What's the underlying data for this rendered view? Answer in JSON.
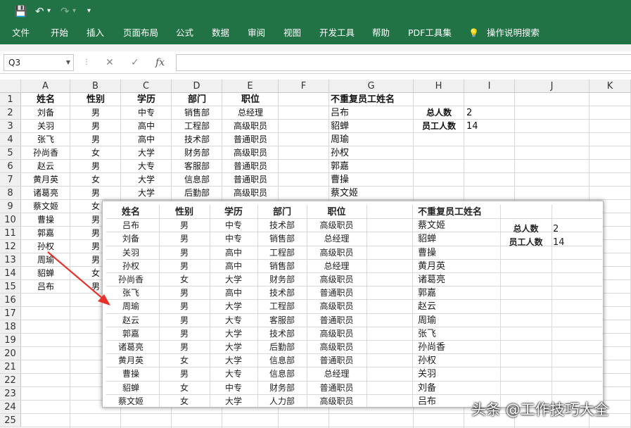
{
  "quick_access": {
    "save_icon": "💾",
    "undo_icon": "↶",
    "undo_dropdown": "▾",
    "redo_icon": "↷",
    "redo_dropdown": "▾",
    "customize_icon": "▾"
  },
  "menu": [
    "文件",
    "开始",
    "插入",
    "页面布局",
    "公式",
    "数据",
    "审阅",
    "视图",
    "开发工具",
    "帮助",
    "PDF工具集"
  ],
  "tell_me": {
    "icon": "💡",
    "label": "操作说明搜索"
  },
  "formula_bar": {
    "name_box": "Q3",
    "cancel": "✕",
    "enter": "✓",
    "fx": "fx",
    "value": ""
  },
  "columns": [
    "A",
    "B",
    "C",
    "D",
    "E",
    "F",
    "G",
    "H",
    "I",
    "J",
    "K"
  ],
  "rows": [
    "1",
    "2",
    "3",
    "4",
    "5",
    "6",
    "7",
    "8",
    "9",
    "10",
    "11",
    "12",
    "13",
    "14",
    "15",
    "16",
    "17",
    "18",
    "19",
    "20",
    "21",
    "22",
    "23",
    "24",
    "25"
  ],
  "sheet": {
    "headers": [
      "姓名",
      "性别",
      "学历",
      "部门",
      "职位"
    ],
    "data": [
      [
        "刘备",
        "男",
        "中专",
        "销售部",
        "总经理"
      ],
      [
        "关羽",
        "男",
        "高中",
        "工程部",
        "高级职员"
      ],
      [
        "张飞",
        "男",
        "高中",
        "技术部",
        "普通职员"
      ],
      [
        "孙尚香",
        "女",
        "大学",
        "财务部",
        "高级职员"
      ],
      [
        "赵云",
        "男",
        "大专",
        "客服部",
        "普通职员"
      ],
      [
        "黄月英",
        "女",
        "大学",
        "信息部",
        "普通职员"
      ],
      [
        "诸葛亮",
        "男",
        "大学",
        "后勤部",
        "高级职员"
      ],
      [
        "蔡文姬",
        "女"
      ],
      [
        "曹操",
        "男"
      ],
      [
        "郭嘉",
        "男"
      ],
      [
        "孙权",
        "男"
      ],
      [
        "周瑜",
        "男"
      ],
      [
        "貂蝉",
        "女"
      ],
      [
        "吕布",
        "男"
      ]
    ],
    "unique_header": "不重复员工姓名",
    "unique_names": [
      "吕布",
      "貂蝉",
      "周瑜",
      "孙权",
      "郭嘉",
      "曹操",
      "蔡文姬"
    ],
    "stats": [
      {
        "label": "总人数",
        "value": "2"
      },
      {
        "label": "员工人数",
        "value": "14"
      }
    ]
  },
  "overlay": {
    "headers": [
      "姓名",
      "性别",
      "学历",
      "部门",
      "职位"
    ],
    "rows": [
      [
        "吕布",
        "男",
        "中专",
        "技术部",
        "高级职员"
      ],
      [
        "刘备",
        "男",
        "中专",
        "销售部",
        "总经理"
      ],
      [
        "关羽",
        "男",
        "高中",
        "工程部",
        "高级职员"
      ],
      [
        "孙权",
        "男",
        "高中",
        "销售部",
        "总经理"
      ],
      [
        "孙尚香",
        "女",
        "大学",
        "财务部",
        "高级职员"
      ],
      [
        "张飞",
        "男",
        "高中",
        "技术部",
        "普通职员"
      ],
      [
        "周瑜",
        "男",
        "大学",
        "工程部",
        "高级职员"
      ],
      [
        "赵云",
        "男",
        "大专",
        "客服部",
        "普通职员"
      ],
      [
        "郭嘉",
        "男",
        "大学",
        "技术部",
        "高级职员"
      ],
      [
        "诸葛亮",
        "男",
        "大学",
        "后勤部",
        "高级职员"
      ],
      [
        "黄月英",
        "女",
        "大学",
        "信息部",
        "普通职员"
      ],
      [
        "曹操",
        "男",
        "大专",
        "信息部",
        "总经理"
      ],
      [
        "貂蝉",
        "女",
        "中专",
        "财务部",
        "普通职员"
      ],
      [
        "蔡文姬",
        "女",
        "大学",
        "人力部",
        "高级职员"
      ]
    ],
    "unique_header": "不重复员工姓名",
    "unique_names": [
      "蔡文姬",
      "貂蝉",
      "曹操",
      "黄月英",
      "诸葛亮",
      "郭嘉",
      "赵云",
      "周瑜",
      "张飞",
      "孙尚香",
      "孙权",
      "关羽",
      "刘备",
      "吕布"
    ],
    "stats": [
      {
        "label": "总人数",
        "value": "2"
      },
      {
        "label": "员工人数",
        "value": "14"
      }
    ]
  },
  "watermark": "头条 @工作技巧大全",
  "colors": {
    "ribbon": "#217346",
    "arrow": "#e8312a"
  }
}
